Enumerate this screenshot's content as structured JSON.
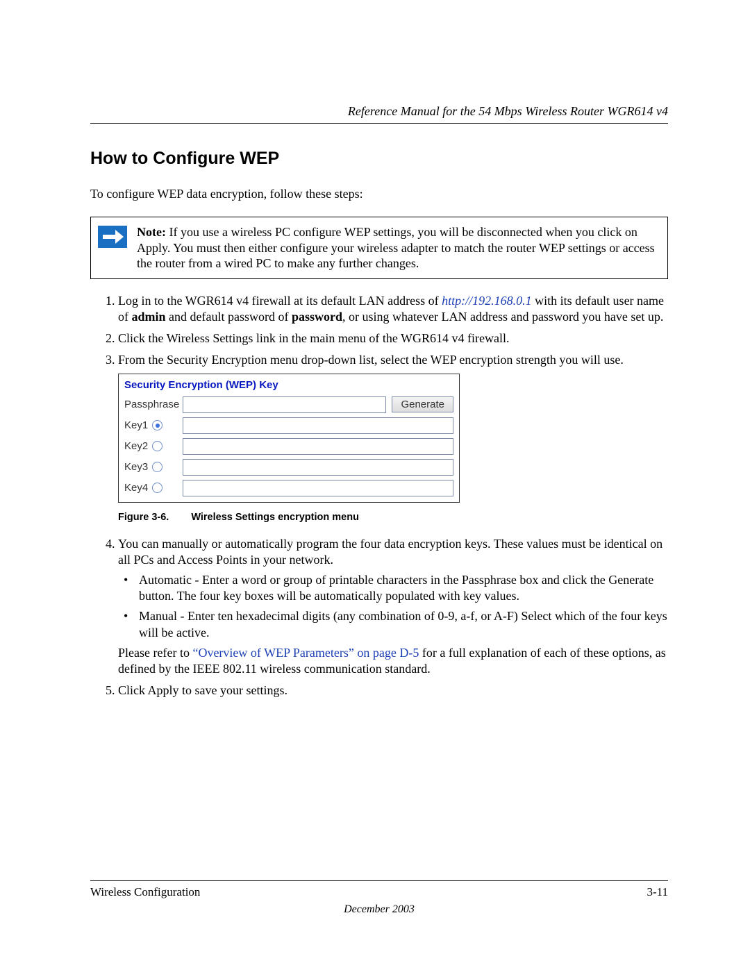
{
  "header": {
    "manual_title": "Reference Manual for the 54 Mbps Wireless Router WGR614 v4"
  },
  "section": {
    "title": "How to Configure WEP",
    "intro": "To configure WEP data encryption, follow these steps:"
  },
  "note": {
    "label": "Note:",
    "text_after": " If you use a wireless PC configure WEP settings, you will be disconnected when you click on Apply. You must then either configure your wireless adapter to match the router WEP settings or access the router from a wired PC to make any further changes."
  },
  "steps": {
    "s1_a": "Log in to the WGR614 v4 firewall at its default LAN address of ",
    "s1_link": "http://192.168.0.1",
    "s1_b": " with its default user name of ",
    "s1_admin": "admin",
    "s1_c": " and default password of ",
    "s1_password": "password",
    "s1_d": ", or using whatever LAN address and password you have set up.",
    "s2": "Click the Wireless Settings link in the main menu of the WGR614 v4 firewall.",
    "s3": "From the Security Encryption menu drop-down list, select the WEP encryption strength you will use.",
    "s4": "You can manually or automatically program the four data encryption keys. These values must be identical on all PCs and Access Points in your network.",
    "s4_b1": "Automatic - Enter a word or group of printable characters in the Passphrase box and click the Generate button. The four key boxes will be automatically populated with key values.",
    "s4_b2": "Manual - Enter ten hexadecimal digits (any combination of 0-9, a-f, or A-F) Select which of the four keys will be active.",
    "s4_ref_a": "Please refer to ",
    "s4_ref_link": "“Overview of WEP Parameters” on page D-5",
    "s4_ref_b": " for a full explanation of each of these options, as defined by the IEEE 802.11 wireless communication standard.",
    "s5": "Click Apply to save your settings."
  },
  "wep_panel": {
    "title": "Security Encryption (WEP) Key",
    "passphrase_label": "Passphrase",
    "generate_label": "Generate",
    "key1": "Key1",
    "key2": "Key2",
    "key3": "Key3",
    "key4": "Key4"
  },
  "figure": {
    "number": "Figure 3-6.",
    "caption": "Wireless Settings encryption menu"
  },
  "footer": {
    "section_name": "Wireless Configuration",
    "page_number": "3-11",
    "date": "December 2003"
  }
}
